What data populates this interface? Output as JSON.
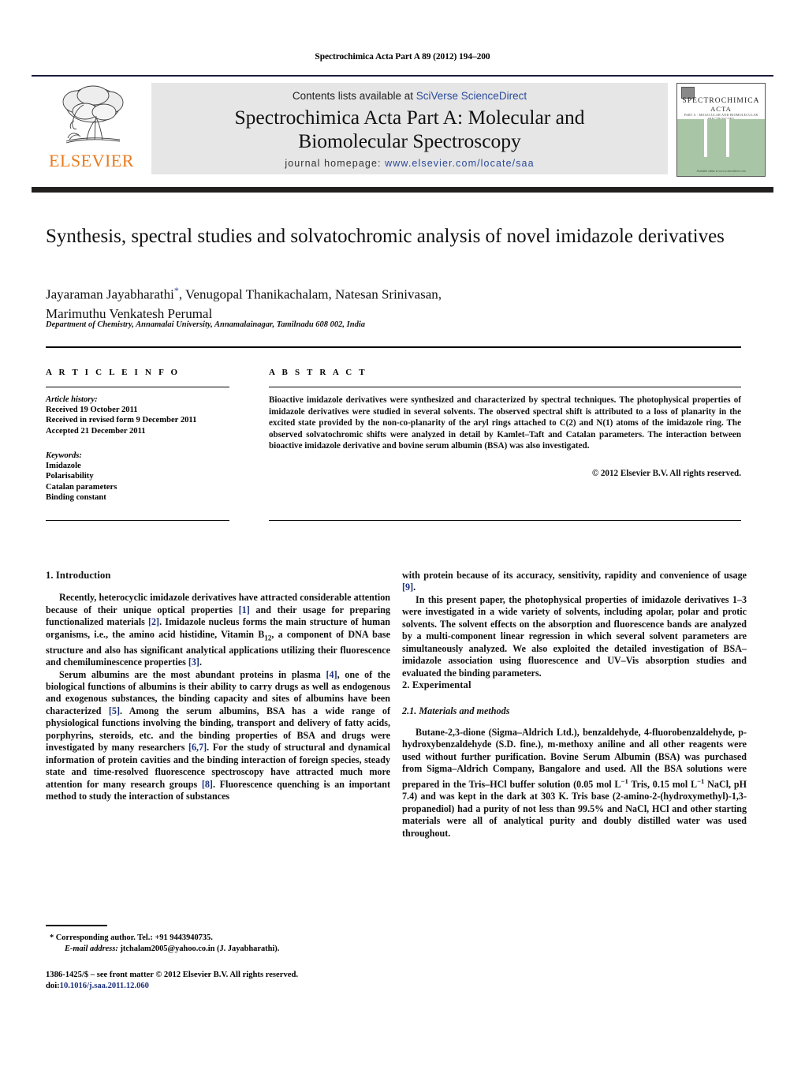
{
  "running_head": "Spectrochimica Acta Part A 89 (2012) 194–200",
  "masthead": {
    "contents_prefix": "Contents lists available at ",
    "contents_link": "SciVerse ScienceDirect",
    "journal_title_line1": "Spectrochimica Acta Part A: Molecular and",
    "journal_title_line2": "Biomolecular Spectroscopy",
    "homepage_label": "journal homepage:",
    "homepage_url": "www.elsevier.com/locate/saa",
    "publisher_wordmark": "ELSEVIER",
    "cover": {
      "line1": "SPECTROCHIMICA",
      "line2": "ACTA",
      "line3": "PART A : MOLECULAR AND BIOMOLECULAR SPECTROSCOPY",
      "footer": "Available online at www.sciencedirect.com"
    }
  },
  "article": {
    "title": "Synthesis, spectral studies and solvatochromic analysis of novel imidazole derivatives",
    "authors_line1": "Jayaraman Jayabharathi",
    "authors_line1_rest": ", Venugopal Thanikachalam, Natesan Srinivasan,",
    "authors_line2": "Marimuthu Venkatesh Perumal",
    "corresponding_marker": "*",
    "affiliation": "Department of Chemistry, Annamalai University, Annamalainagar, Tamilnadu 608 002, India"
  },
  "info": {
    "heading": "A R T I C L E    I N F O",
    "history_label": "Article history:",
    "history": [
      "Received 19 October 2011",
      "Received in revised form 9 December 2011",
      "Accepted 21 December 2011"
    ],
    "keywords_label": "Keywords:",
    "keywords": [
      "Imidazole",
      "Polarisability",
      "Catalan parameters",
      "Binding constant"
    ]
  },
  "abstract": {
    "heading": "A B S T R A C T",
    "text": "Bioactive imidazole derivatives were synthesized and characterized by spectral techniques. The photophysical properties of imidazole derivatives were studied in several solvents. The observed spectral shift is attributed to a loss of planarity in the excited state provided by the non-co-planarity of the aryl rings attached to C(2) and N(1) atoms of the imidazole ring. The observed solvatochromic shifts were analyzed in detail by Kamlet–Taft and Catalan parameters. The interaction between bioactive imidazole derivative and bovine serum albumin (BSA) was also investigated.",
    "copyright": "© 2012 Elsevier B.V. All rights reserved."
  },
  "body": {
    "intro_heading": "1.  Introduction",
    "intro_p1_a": "Recently, heterocyclic imidazole derivatives have attracted considerable attention because of their unique optical properties ",
    "intro_p1_c1": "[1]",
    "intro_p1_b": " and their usage for preparing functionalized materials ",
    "intro_p1_c2": "[2]",
    "intro_p1_d": ". Imidazole nucleus forms the main structure of human organisms, i.e., the amino acid histidine, Vitamin B",
    "intro_p1_sub": "12",
    "intro_p1_e": ", a component of DNA base structure and also has significant analytical applications utilizing their fluorescence and chemiluminescence properties ",
    "intro_p1_c3": "[3]",
    "intro_p1_f": ".",
    "intro_p2_a": "Serum albumins are the most abundant proteins in plasma ",
    "intro_p2_c1": "[4]",
    "intro_p2_b": ", one of the biological functions of albumins is their ability to carry drugs as well as endogenous and exogenous substances, the binding capacity and sites of albumins have been characterized ",
    "intro_p2_c2": "[5]",
    "intro_p2_c": ". Among the serum albumins, BSA has a wide range of physiological functions involving the binding, transport and delivery of fatty acids, porphyrins, steroids, etc. and the binding properties of BSA and drugs were investigated by many researchers ",
    "intro_p2_c3": "[6,7]",
    "intro_p2_d": ". For the study of structural and dynamical information of protein cavities and the binding interaction of foreign species, steady state and time-resolved fluorescence spectroscopy have attracted much more attention for many research groups ",
    "intro_p2_c4": "[8]",
    "intro_p2_e": ". Fluorescence quenching is an important method to study the interaction of substances",
    "right_p1_a": "with protein because of its accuracy, sensitivity, rapidity and convenience of usage ",
    "right_p1_c1": "[9]",
    "right_p1_b": ".",
    "right_p2_a": "In this present paper, the photophysical properties of imidazole derivatives ",
    "right_p2_bold": "1–3",
    "right_p2_b": " were investigated in a wide variety of solvents, including apolar, polar and protic solvents. The solvent effects on the absorption and fluorescence bands are analyzed by a multi-component linear regression in which several solvent parameters are simultaneously analyzed. We also exploited the detailed investigation of BSA–imidazole association using fluorescence and UV–Vis absorption studies and evaluated the binding parameters.",
    "exp_heading": "2.  Experimental",
    "exp_sub_heading": "2.1.  Materials and methods",
    "exp_p1_a": "Butane-2,3-dione (Sigma–Aldrich Ltd.), benzaldehyde, 4-fluorobenzaldehyde, p-hydroxybenzaldehyde (S.D. fine.), m-methoxy aniline and all other reagents were used without further purification. Bovine Serum Albumin (BSA) was purchased from Sigma–Aldrich Company, Bangalore and used. All the BSA solutions were prepared in the Tris–HCl buffer solution (0.05 mol L",
    "exp_sup1": "−1",
    "exp_p1_b": " Tris, 0.15 mol L",
    "exp_sup2": "−1",
    "exp_p1_c": " NaCl, pH 7.4) and was kept in the dark at 303 K. Tris base (2-amino-2-(hydroxymethyl)-1,3-propanediol) had a purity of not less than 99.5% and NaCl, HCl and other starting materials were all of analytical purity and doubly distilled water was used throughout."
  },
  "footer": {
    "corresponding": "* Corresponding author. Tel.: +91 9443940735.",
    "email_label": "E-mail address:",
    "email": "jtchalam2005@yahoo.co.in",
    "email_attrib": "(J. Jayabharathi).",
    "imprint": "1386-1425/$ – see front matter © 2012 Elsevier B.V. All rights reserved.",
    "doi_label": "doi:",
    "doi": "10.1016/j.saa.2011.12.060"
  }
}
